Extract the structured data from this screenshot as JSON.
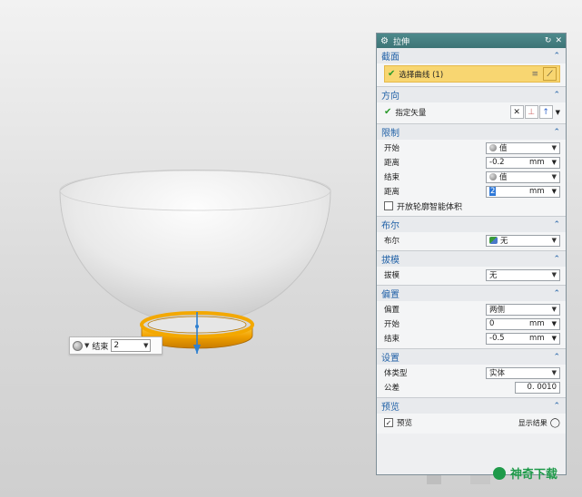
{
  "colors": {
    "accent_teal": "#3d7476",
    "section_header_text": "#2363a8",
    "selection_highlight": "#f8d671",
    "ring_color": "#f0a000",
    "watermark_green": "#1f9a4a"
  },
  "viewport": {
    "mini_toolbar": {
      "icon": "sphere-body-icon",
      "label": "结束",
      "value": "2"
    }
  },
  "dialog": {
    "title": "拉伸",
    "title_icons": [
      "gear-icon",
      "reset-icon",
      "close-icon"
    ],
    "sections": {
      "section_jiemian": {
        "header": "截面",
        "select_curve_label": "选择曲线 (1)"
      },
      "direction": {
        "header": "方向",
        "vector_label": "指定矢量"
      },
      "limits": {
        "header": "限制",
        "start_label": "开始",
        "start_value": "值",
        "distance1_label": "距离",
        "distance1_value": "-0.2",
        "distance1_unit": "mm",
        "end_label": "结束",
        "end_value": "值",
        "distance2_label": "距离",
        "distance2_value": "2",
        "distance2_unit": "mm",
        "open_profile_label": "开放轮廓智能体积"
      },
      "boolean": {
        "header": "布尔",
        "label": "布尔",
        "value": "无"
      },
      "draft": {
        "header": "拔模",
        "label": "拔模",
        "value": "无"
      },
      "offset": {
        "header": "偏置",
        "offset_label": "偏置",
        "offset_value": "两侧",
        "start_label": "开始",
        "start_value": "0",
        "start_unit": "mm",
        "end_label": "结束",
        "end_value": "-0.5",
        "end_unit": "mm"
      },
      "settings": {
        "header": "设置",
        "body_type_label": "体类型",
        "body_type_value": "实体",
        "tolerance_label": "公差",
        "tolerance_value": "0. 0010"
      },
      "preview": {
        "header": "预览",
        "preview_label": "预览",
        "show_result_label": "显示结果"
      }
    }
  },
  "watermark": {
    "text": "神奇下载"
  }
}
